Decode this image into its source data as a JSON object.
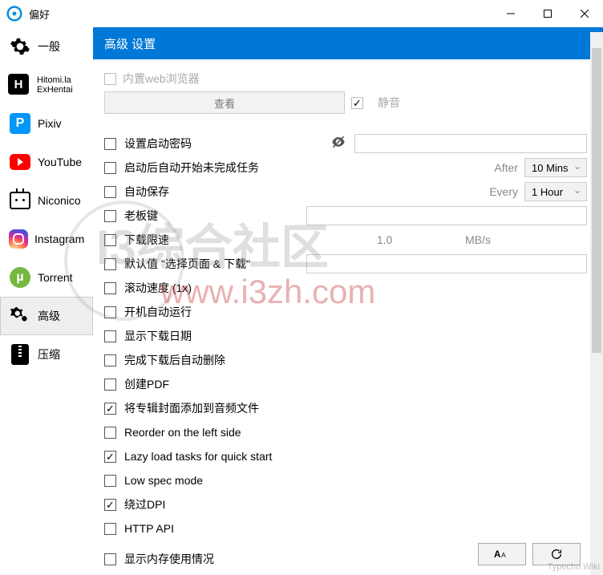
{
  "window": {
    "title": "偏好"
  },
  "sidebar": {
    "items": [
      {
        "label": "一般"
      },
      {
        "label1": "Hitomi.la",
        "label2": "ExHentai"
      },
      {
        "label": "Pixiv"
      },
      {
        "label": "YouTube"
      },
      {
        "label": "Niconico"
      },
      {
        "label": "Instagram"
      },
      {
        "label": "Torrent"
      },
      {
        "label": "高级"
      },
      {
        "label": "压缩"
      }
    ]
  },
  "header": {
    "title": "高级 设置"
  },
  "builtin": {
    "browser_label": "内置web浏览器",
    "view_btn": "查看",
    "mute_label": "静音"
  },
  "opts": {
    "password": "设置启动密码",
    "auto_start": "启动后自动开始未完成任务",
    "after_label": "After",
    "after_value": "10 Mins",
    "autosave": "自动保存",
    "every_label": "Every",
    "every_value": "1 Hour",
    "boss_key": "老板键",
    "speed_limit": "下载限速",
    "speed_value": "1.0",
    "speed_unit": "MB/s",
    "default_select": "默认值 \"选择页面 & 下载\"",
    "scroll_speed": "滚动速度 (1x)",
    "autorun": "开机自动运行",
    "show_date": "显示下载日期",
    "auto_delete": "完成下载后自动删除",
    "create_pdf": "创建PDF",
    "album_cover": "将专辑封面添加到音频文件",
    "reorder": "Reorder on the left side",
    "lazy_load": "Lazy load tasks for quick start",
    "low_spec": "Low spec mode",
    "bypass_dpi": "绕过DPI",
    "http_api": "HTTP API",
    "show_memory": "显示内存使用情况"
  },
  "watermark": {
    "text": "I3综合社区",
    "url": "www.i3zh.com",
    "footer": "Typecho.Wiki"
  }
}
